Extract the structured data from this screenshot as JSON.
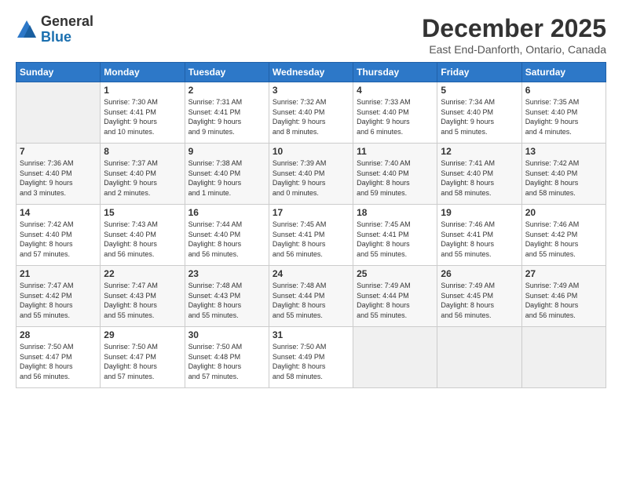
{
  "logo": {
    "line1": "General",
    "line2": "Blue"
  },
  "header": {
    "title": "December 2025",
    "location": "East End-Danforth, Ontario, Canada"
  },
  "days_of_week": [
    "Sunday",
    "Monday",
    "Tuesday",
    "Wednesday",
    "Thursday",
    "Friday",
    "Saturday"
  ],
  "weeks": [
    [
      {
        "day": "",
        "info": ""
      },
      {
        "day": "1",
        "info": "Sunrise: 7:30 AM\nSunset: 4:41 PM\nDaylight: 9 hours\nand 10 minutes."
      },
      {
        "day": "2",
        "info": "Sunrise: 7:31 AM\nSunset: 4:41 PM\nDaylight: 9 hours\nand 9 minutes."
      },
      {
        "day": "3",
        "info": "Sunrise: 7:32 AM\nSunset: 4:40 PM\nDaylight: 9 hours\nand 8 minutes."
      },
      {
        "day": "4",
        "info": "Sunrise: 7:33 AM\nSunset: 4:40 PM\nDaylight: 9 hours\nand 6 minutes."
      },
      {
        "day": "5",
        "info": "Sunrise: 7:34 AM\nSunset: 4:40 PM\nDaylight: 9 hours\nand 5 minutes."
      },
      {
        "day": "6",
        "info": "Sunrise: 7:35 AM\nSunset: 4:40 PM\nDaylight: 9 hours\nand 4 minutes."
      }
    ],
    [
      {
        "day": "7",
        "info": "Sunrise: 7:36 AM\nSunset: 4:40 PM\nDaylight: 9 hours\nand 3 minutes."
      },
      {
        "day": "8",
        "info": "Sunrise: 7:37 AM\nSunset: 4:40 PM\nDaylight: 9 hours\nand 2 minutes."
      },
      {
        "day": "9",
        "info": "Sunrise: 7:38 AM\nSunset: 4:40 PM\nDaylight: 9 hours\nand 1 minute."
      },
      {
        "day": "10",
        "info": "Sunrise: 7:39 AM\nSunset: 4:40 PM\nDaylight: 9 hours\nand 0 minutes."
      },
      {
        "day": "11",
        "info": "Sunrise: 7:40 AM\nSunset: 4:40 PM\nDaylight: 8 hours\nand 59 minutes."
      },
      {
        "day": "12",
        "info": "Sunrise: 7:41 AM\nSunset: 4:40 PM\nDaylight: 8 hours\nand 58 minutes."
      },
      {
        "day": "13",
        "info": "Sunrise: 7:42 AM\nSunset: 4:40 PM\nDaylight: 8 hours\nand 58 minutes."
      }
    ],
    [
      {
        "day": "14",
        "info": "Sunrise: 7:42 AM\nSunset: 4:40 PM\nDaylight: 8 hours\nand 57 minutes."
      },
      {
        "day": "15",
        "info": "Sunrise: 7:43 AM\nSunset: 4:40 PM\nDaylight: 8 hours\nand 56 minutes."
      },
      {
        "day": "16",
        "info": "Sunrise: 7:44 AM\nSunset: 4:40 PM\nDaylight: 8 hours\nand 56 minutes."
      },
      {
        "day": "17",
        "info": "Sunrise: 7:45 AM\nSunset: 4:41 PM\nDaylight: 8 hours\nand 56 minutes."
      },
      {
        "day": "18",
        "info": "Sunrise: 7:45 AM\nSunset: 4:41 PM\nDaylight: 8 hours\nand 55 minutes."
      },
      {
        "day": "19",
        "info": "Sunrise: 7:46 AM\nSunset: 4:41 PM\nDaylight: 8 hours\nand 55 minutes."
      },
      {
        "day": "20",
        "info": "Sunrise: 7:46 AM\nSunset: 4:42 PM\nDaylight: 8 hours\nand 55 minutes."
      }
    ],
    [
      {
        "day": "21",
        "info": "Sunrise: 7:47 AM\nSunset: 4:42 PM\nDaylight: 8 hours\nand 55 minutes."
      },
      {
        "day": "22",
        "info": "Sunrise: 7:47 AM\nSunset: 4:43 PM\nDaylight: 8 hours\nand 55 minutes."
      },
      {
        "day": "23",
        "info": "Sunrise: 7:48 AM\nSunset: 4:43 PM\nDaylight: 8 hours\nand 55 minutes."
      },
      {
        "day": "24",
        "info": "Sunrise: 7:48 AM\nSunset: 4:44 PM\nDaylight: 8 hours\nand 55 minutes."
      },
      {
        "day": "25",
        "info": "Sunrise: 7:49 AM\nSunset: 4:44 PM\nDaylight: 8 hours\nand 55 minutes."
      },
      {
        "day": "26",
        "info": "Sunrise: 7:49 AM\nSunset: 4:45 PM\nDaylight: 8 hours\nand 56 minutes."
      },
      {
        "day": "27",
        "info": "Sunrise: 7:49 AM\nSunset: 4:46 PM\nDaylight: 8 hours\nand 56 minutes."
      }
    ],
    [
      {
        "day": "28",
        "info": "Sunrise: 7:50 AM\nSunset: 4:47 PM\nDaylight: 8 hours\nand 56 minutes."
      },
      {
        "day": "29",
        "info": "Sunrise: 7:50 AM\nSunset: 4:47 PM\nDaylight: 8 hours\nand 57 minutes."
      },
      {
        "day": "30",
        "info": "Sunrise: 7:50 AM\nSunset: 4:48 PM\nDaylight: 8 hours\nand 57 minutes."
      },
      {
        "day": "31",
        "info": "Sunrise: 7:50 AM\nSunset: 4:49 PM\nDaylight: 8 hours\nand 58 minutes."
      },
      {
        "day": "",
        "info": ""
      },
      {
        "day": "",
        "info": ""
      },
      {
        "day": "",
        "info": ""
      }
    ]
  ]
}
